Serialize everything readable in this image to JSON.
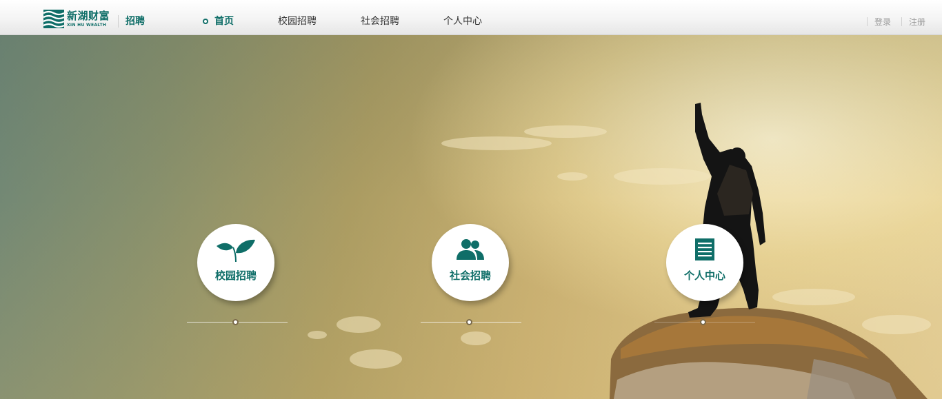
{
  "brand": {
    "name_cn": "新湖财富",
    "name_en": "XIN HU WEALTH",
    "section": "招聘",
    "color": "#0f6e68"
  },
  "nav": {
    "items": [
      {
        "label": "首页",
        "active": true
      },
      {
        "label": "校园招聘",
        "active": false
      },
      {
        "label": "社会招聘",
        "active": false
      },
      {
        "label": "个人中心",
        "active": false
      }
    ]
  },
  "account": {
    "login": "登录",
    "register": "注册"
  },
  "hero": {
    "cards": [
      {
        "label": "校园招聘",
        "icon": "sprout-icon"
      },
      {
        "label": "社会招聘",
        "icon": "users-icon"
      },
      {
        "label": "个人中心",
        "icon": "document-list-icon"
      }
    ]
  }
}
